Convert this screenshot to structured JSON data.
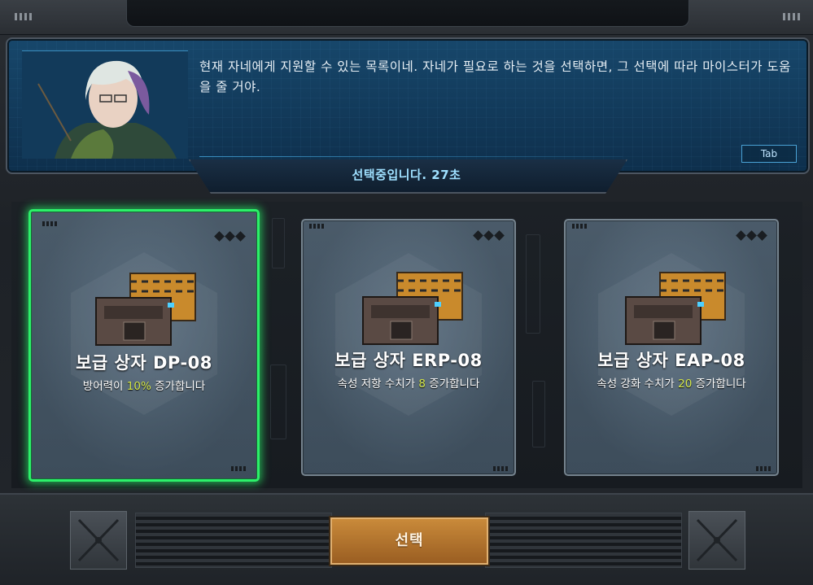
{
  "dialog": {
    "text": "현재 자네에게 지원할 수 있는 목록이네. 자네가 필요로 하는 것을 선택하면, 그 선택에 따라 마이스터가 도움을 줄 거야.",
    "tab_key": "Tab"
  },
  "timer": {
    "text": "선택중입니다. 27초"
  },
  "cards": [
    {
      "title": "보급 상자 DP-08",
      "desc_pre": "방어력이 ",
      "desc_value": "10%",
      "desc_post": " 증가합니다",
      "selected": true
    },
    {
      "title": "보급 상자 ERP-08",
      "desc_pre": "속성 저항 수치가 ",
      "desc_value": "8",
      "desc_post": " 증가합니다",
      "selected": false
    },
    {
      "title": "보급 상자 EAP-08",
      "desc_pre": "속성 강화 수치가 ",
      "desc_value": "20",
      "desc_post": " 증가합니다",
      "selected": false
    }
  ],
  "actions": {
    "select_label": "선택"
  },
  "colors": {
    "selected_border": "#2cf06a",
    "highlight_value": "#d6e84a",
    "timer_text": "#9fe0ff",
    "button": "#b57530"
  },
  "icons": [
    "supply-crate-icon",
    "close-x-icon",
    "grip-icon",
    "diamond-rank-icon"
  ]
}
